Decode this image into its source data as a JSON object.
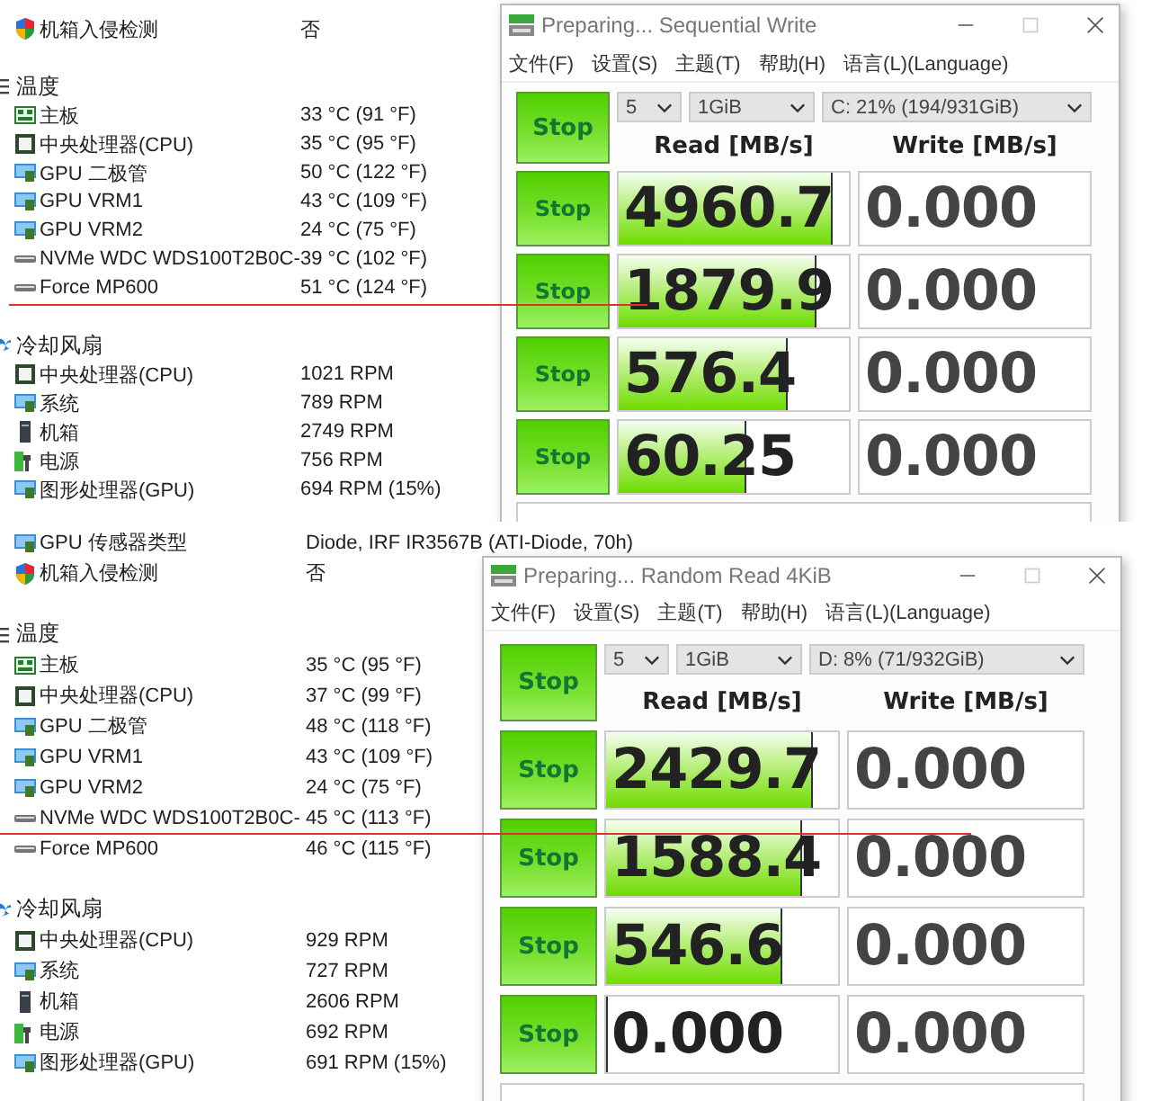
{
  "panels": [
    {
      "info": [
        {
          "label": "机箱入侵检测",
          "value": "否",
          "kind": "shield"
        }
      ],
      "groups": [
        {
          "title": "温度",
          "kind": "temp",
          "items": [
            {
              "label": "主板",
              "value": "33 °C  (91 °F)",
              "kind": "board",
              "marked": false
            },
            {
              "label": "中央处理器(CPU)",
              "value": "35 °C  (95 °F)",
              "kind": "cpu",
              "marked": false
            },
            {
              "label": "GPU 二极管",
              "value": "50 °C  (122 °F)",
              "kind": "monitor",
              "marked": false
            },
            {
              "label": "GPU VRM1",
              "value": "43 °C  (109 °F)",
              "kind": "monitor",
              "marked": false
            },
            {
              "label": "GPU VRM2",
              "value": "24 °C  (75 °F)",
              "kind": "monitor",
              "marked": false
            },
            {
              "label": "NVMe WDC WDS100T2B0C-",
              "value": "39 °C  (102 °F)",
              "kind": "drive",
              "marked": false
            },
            {
              "label": "Force MP600",
              "value": "51 °C  (124 °F)",
              "kind": "drive",
              "marked": true
            }
          ]
        },
        {
          "title": "冷却风扇",
          "kind": "fan",
          "items": [
            {
              "label": "中央处理器(CPU)",
              "value": "1021 RPM",
              "kind": "cpu",
              "marked": false
            },
            {
              "label": "系统",
              "value": "789 RPM",
              "kind": "monitor",
              "marked": false
            },
            {
              "label": "机箱",
              "value": "2749 RPM",
              "kind": "case",
              "marked": false
            },
            {
              "label": "电源",
              "value": "756 RPM",
              "kind": "power",
              "marked": false
            },
            {
              "label": "图形处理器(GPU)",
              "value": "694 RPM  (15%)",
              "kind": "monitor",
              "marked": false
            }
          ]
        }
      ],
      "benchmark": {
        "title": "Preparing... Sequential Write",
        "menu": [
          "文件(F)",
          "设置(S)",
          "主题(T)",
          "帮助(H)",
          "语言(L)(Language)"
        ],
        "count": "5",
        "size": "1GiB",
        "drive": "C: 21% (194/931GiB)",
        "main_button": "Stop",
        "read_header": "Read [MB/s]",
        "write_header": "Write [MB/s]",
        "rows": [
          {
            "button": "Stop",
            "read": "4960.7",
            "level": 0.92,
            "write": "0.000"
          },
          {
            "button": "Stop",
            "read": "1879.9",
            "level": 0.85,
            "write": "0.000"
          },
          {
            "button": "Stop",
            "read": "576.4",
            "level": 0.73,
            "write": "0.000"
          },
          {
            "button": "Stop",
            "read": "60.25",
            "level": 0.55,
            "write": "0.000"
          }
        ]
      }
    },
    {
      "info": [
        {
          "label": "GPU 传感器类型",
          "value": "Diode, IRF IR3567B  (ATI-Diode, 70h)",
          "kind": "monitor"
        },
        {
          "label": "机箱入侵检测",
          "value": "否",
          "kind": "shield"
        }
      ],
      "groups": [
        {
          "title": "温度",
          "kind": "temp",
          "items": [
            {
              "label": "主板",
              "value": "35 °C  (95 °F)",
              "kind": "board",
              "marked": false
            },
            {
              "label": "中央处理器(CPU)",
              "value": "37 °C  (99 °F)",
              "kind": "cpu",
              "marked": false
            },
            {
              "label": "GPU 二极管",
              "value": "48 °C  (118 °F)",
              "kind": "monitor",
              "marked": false
            },
            {
              "label": "GPU VRM1",
              "value": "43 °C  (109 °F)",
              "kind": "monitor",
              "marked": false
            },
            {
              "label": "GPU VRM2",
              "value": "24 °C  (75 °F)",
              "kind": "monitor",
              "marked": false
            },
            {
              "label": "NVMe WDC WDS100T2B0C-",
              "value": "45 °C  (113 °F)",
              "kind": "drive",
              "marked": true
            },
            {
              "label": "Force MP600",
              "value": "46 °C  (115 °F)",
              "kind": "drive",
              "marked": false
            }
          ]
        },
        {
          "title": "冷却风扇",
          "kind": "fan",
          "items": [
            {
              "label": "中央处理器(CPU)",
              "value": "929 RPM",
              "kind": "cpu",
              "marked": false
            },
            {
              "label": "系统",
              "value": "727 RPM",
              "kind": "monitor",
              "marked": false
            },
            {
              "label": "机箱",
              "value": "2606 RPM",
              "kind": "case",
              "marked": false
            },
            {
              "label": "电源",
              "value": "692 RPM",
              "kind": "power",
              "marked": false
            },
            {
              "label": "图形处理器(GPU)",
              "value": "691 RPM  (15%)",
              "kind": "monitor",
              "marked": false
            }
          ]
        }
      ],
      "benchmark": {
        "title": "Preparing... Random Read 4KiB",
        "menu": [
          "文件(F)",
          "设置(S)",
          "主题(T)",
          "帮助(H)",
          "语言(L)(Language)"
        ],
        "count": "5",
        "size": "1GiB",
        "drive": "D: 8% (71/932GiB)",
        "main_button": "Stop",
        "read_header": "Read [MB/s]",
        "write_header": "Write [MB/s]",
        "rows": [
          {
            "button": "Stop",
            "read": "2429.7",
            "level": 0.88,
            "write": "0.000"
          },
          {
            "button": "Stop",
            "read": "1588.4",
            "level": 0.84,
            "write": "0.000"
          },
          {
            "button": "Stop",
            "read": "546.6",
            "level": 0.75,
            "write": "0.000"
          },
          {
            "button": "Stop",
            "read": "0.000",
            "level": 0,
            "write": "0.000"
          }
        ]
      }
    }
  ]
}
